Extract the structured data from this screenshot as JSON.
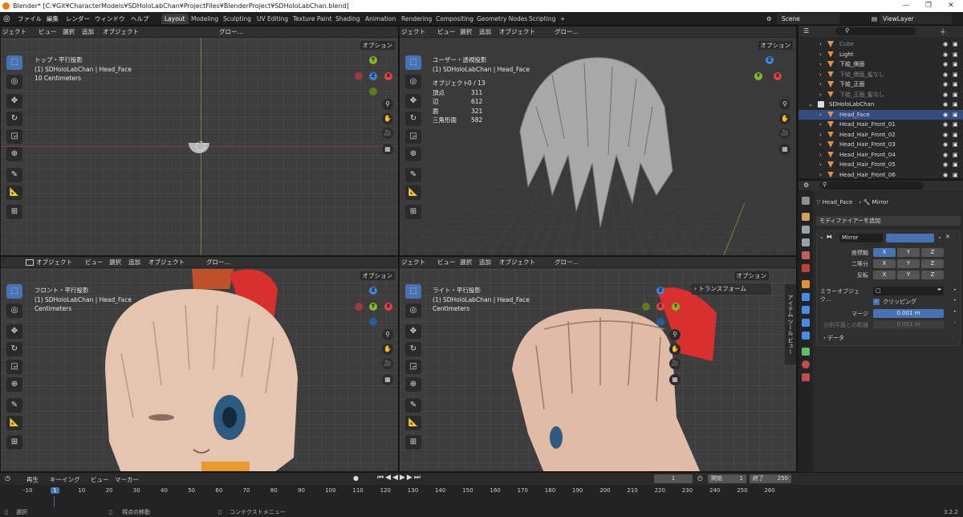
{
  "window": {
    "title": "Blender* [C:¥Git¥CharacterModels¥SDHoloLabChan¥ProjectFiles¥BlenderProject¥SDHoloLabChan.blend]"
  },
  "menu": [
    "ファイル",
    "編集",
    "レンダー",
    "ウィンドウ",
    "ヘルプ"
  ],
  "workspaces": [
    "Layout",
    "Modeling",
    "Sculpting",
    "UV Editing",
    "Texture Paint",
    "Shading",
    "Animation",
    "Rendering",
    "Compositing",
    "Geometry Nodes",
    "Scripting"
  ],
  "active_workspace": "Layout",
  "add_tab": "+",
  "scene": "Scene",
  "view_layer": "ViewLayer",
  "viewport_header": {
    "mode": "ジェクト",
    "object_mode": "オブジェクト",
    "view": "ビュー",
    "select": "選択",
    "add": "追加",
    "object": "オブジェクト",
    "orient": "グロー…",
    "options": "オプション"
  },
  "viewports": [
    {
      "name": "top",
      "label": "トップ・平行投影",
      "sub": "(1) SDHoloLabChan | Head_Face",
      "scale": "10 Centimeters"
    },
    {
      "name": "user",
      "label": "ユーザー・透視投影",
      "sub": "(1) SDHoloLabChan | Head_Face",
      "scale": ""
    },
    {
      "name": "front",
      "label": "フロント・平行投影",
      "sub": "(1) SDHoloLabChan | Head_Face",
      "scale": "Centimeters"
    },
    {
      "name": "right",
      "label": "ライト・平行投影",
      "sub": "(1) SDHoloLabChan | Head_Face",
      "scale": "Centimeters"
    }
  ],
  "stats": {
    "objects_label": "オブジェクト",
    "objects": "0 / 13",
    "verts_label": "頂点",
    "verts": "311",
    "edges_label": "辺",
    "edges": "612",
    "faces_label": "面",
    "faces": "321",
    "tris_label": "三角形面",
    "tris": "582"
  },
  "n_panel": {
    "transform": "トランスフォーム",
    "tabs": [
      "アイテム",
      "ツール",
      "ビュー"
    ]
  },
  "gizmo": {
    "x": "X",
    "y": "Y",
    "z": "Z"
  },
  "outliner": {
    "search_placeholder": "",
    "rows": [
      {
        "name": "Cube",
        "dim": true
      },
      {
        "name": "Light",
        "dim": false
      },
      {
        "name": "下絵_側面",
        "dim": false
      },
      {
        "name": "下絵_側面_髪なし",
        "dim": true
      },
      {
        "name": "下絵_正面",
        "dim": false
      },
      {
        "name": "下絵_正面_髪なし",
        "dim": true
      },
      {
        "name": "SDHoloLabChan",
        "dim": false,
        "collection": true
      },
      {
        "name": "Head_Face",
        "dim": false,
        "selected": true
      },
      {
        "name": "Head_Hair_Front_01",
        "dim": false
      },
      {
        "name": "Head_Hair_Front_02",
        "dim": false
      },
      {
        "name": "Head_Hair_Front_03",
        "dim": false
      },
      {
        "name": "Head_Hair_Front_04",
        "dim": false
      },
      {
        "name": "Head_Hair_Front_05",
        "dim": false
      },
      {
        "name": "Head_Hair_Front_06",
        "dim": false
      }
    ]
  },
  "properties": {
    "object_name": "Head_Face",
    "modifier_name_crumb": "Mirror",
    "add_modifier": "モディファイアーを追加",
    "modifier": {
      "name": "Mirror",
      "axis_label": "座標軸",
      "bisect_label": "二等分",
      "flip_label": "反転",
      "axes": [
        "X",
        "Y",
        "Z"
      ],
      "mirror_object_label": "ミラーオブジェク…",
      "clipping_label": "クリッピング",
      "merge_label": "マージ",
      "merge_value": "0.001 m",
      "bisect_distance_label": "分割平面との距離",
      "bisect_distance_value": "0.001 m",
      "data_label": "データ"
    }
  },
  "timeline": {
    "playback": "再生",
    "keying": "キーイング",
    "view": "ビュー",
    "marker": "マーカー",
    "current_frame": "1",
    "start_label": "開始",
    "start": "1",
    "end_label": "終了",
    "end": "250",
    "ticks": [
      "-10",
      "1",
      "10",
      "20",
      "30",
      "40",
      "50",
      "60",
      "70",
      "80",
      "90",
      "100",
      "110",
      "120",
      "130",
      "140",
      "150",
      "160",
      "170",
      "180",
      "190",
      "200",
      "210",
      "220",
      "230",
      "240",
      "250",
      "260"
    ]
  },
  "status": {
    "select": "選択",
    "rotate_view": "視点の移動",
    "context_menu": "コンテクストメニュー",
    "version": "3.2.2"
  },
  "colors": {
    "accent": "#4772b3",
    "orange": "#e87d0d",
    "x_axis": "#e0434c",
    "y_axis": "#83b829",
    "z_axis": "#3e83d8"
  }
}
